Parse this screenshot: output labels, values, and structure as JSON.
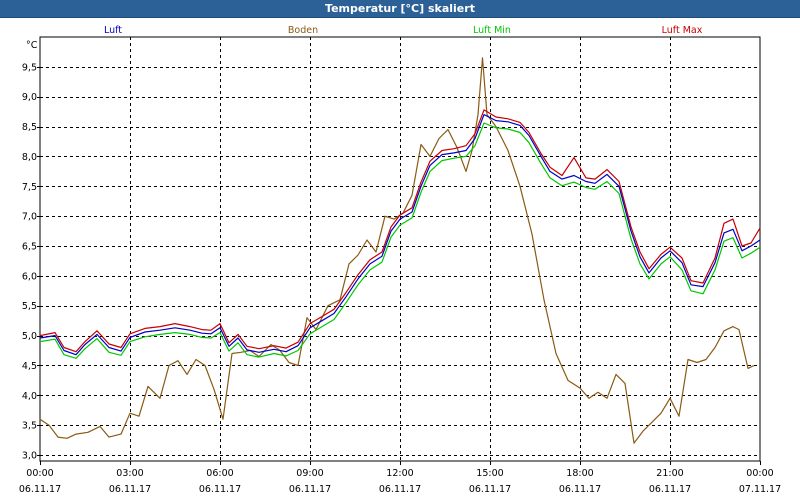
{
  "window": {
    "title": "Temperatur [°C] skaliert"
  },
  "chart_data": {
    "type": "line",
    "unit": "°C",
    "ylim": [
      2.9,
      10.0
    ],
    "yticks": [
      3.0,
      3.5,
      4.0,
      4.5,
      5.0,
      5.5,
      6.0,
      6.5,
      7.0,
      7.5,
      8.0,
      8.5,
      9.0,
      9.5
    ],
    "ytick_labels": [
      "3,0",
      "3,5",
      "4,0",
      "4,5",
      "5,0",
      "5,5",
      "6,0",
      "6,5",
      "7,0",
      "7,5",
      "8,0",
      "8,5",
      "9,0",
      "9,5"
    ],
    "xlim": [
      0,
      24
    ],
    "xticks": [
      0,
      3,
      6,
      9,
      12,
      15,
      18,
      21,
      24
    ],
    "xtick_times": [
      "00:00",
      "03:00",
      "06:00",
      "09:00",
      "12:00",
      "15:00",
      "18:00",
      "21:00",
      "00:00"
    ],
    "xtick_dates": [
      "06.11.17",
      "06.11.17",
      "06.11.17",
      "06.11.17",
      "06.11.17",
      "06.11.17",
      "06.11.17",
      "06.11.17",
      "07.11.17"
    ],
    "grid": true,
    "legend_position": "top",
    "series": [
      {
        "name": "Luft",
        "color": "#0000c8",
        "points": [
          [
            0,
            4.96
          ],
          [
            0.5,
            5.0
          ],
          [
            0.8,
            4.75
          ],
          [
            1.2,
            4.68
          ],
          [
            1.5,
            4.85
          ],
          [
            1.9,
            5.02
          ],
          [
            2.3,
            4.8
          ],
          [
            2.7,
            4.74
          ],
          [
            3.0,
            4.97
          ],
          [
            3.5,
            5.06
          ],
          [
            4.0,
            5.09
          ],
          [
            4.5,
            5.13
          ],
          [
            5.0,
            5.09
          ],
          [
            5.4,
            5.04
          ],
          [
            5.7,
            5.03
          ],
          [
            6.0,
            5.13
          ],
          [
            6.3,
            4.82
          ],
          [
            6.6,
            4.96
          ],
          [
            6.9,
            4.76
          ],
          [
            7.3,
            4.72
          ],
          [
            7.8,
            4.77
          ],
          [
            8.2,
            4.73
          ],
          [
            8.6,
            4.83
          ],
          [
            9.0,
            5.13
          ],
          [
            9.4,
            5.25
          ],
          [
            9.8,
            5.37
          ],
          [
            10.2,
            5.65
          ],
          [
            10.6,
            5.95
          ],
          [
            11.0,
            6.2
          ],
          [
            11.4,
            6.33
          ],
          [
            11.7,
            6.75
          ],
          [
            12.0,
            6.95
          ],
          [
            12.4,
            7.07
          ],
          [
            12.7,
            7.5
          ],
          [
            13.0,
            7.85
          ],
          [
            13.4,
            8.03
          ],
          [
            13.8,
            8.06
          ],
          [
            14.2,
            8.1
          ],
          [
            14.5,
            8.3
          ],
          [
            14.8,
            8.7
          ],
          [
            15.2,
            8.6
          ],
          [
            15.6,
            8.58
          ],
          [
            16.0,
            8.52
          ],
          [
            16.3,
            8.35
          ],
          [
            16.7,
            8.0
          ],
          [
            17.0,
            7.75
          ],
          [
            17.4,
            7.62
          ],
          [
            17.8,
            7.68
          ],
          [
            18.2,
            7.58
          ],
          [
            18.5,
            7.55
          ],
          [
            18.9,
            7.7
          ],
          [
            19.3,
            7.5
          ],
          [
            19.7,
            6.75
          ],
          [
            20.0,
            6.32
          ],
          [
            20.3,
            6.05
          ],
          [
            20.7,
            6.3
          ],
          [
            21.0,
            6.42
          ],
          [
            21.4,
            6.22
          ],
          [
            21.7,
            5.85
          ],
          [
            22.1,
            5.82
          ],
          [
            22.5,
            6.22
          ],
          [
            22.8,
            6.72
          ],
          [
            23.1,
            6.78
          ],
          [
            23.4,
            6.42
          ],
          [
            23.7,
            6.5
          ],
          [
            24.0,
            6.6
          ]
        ]
      },
      {
        "name": "Boden",
        "color": "#8b5a14",
        "points": [
          [
            0,
            3.6
          ],
          [
            0.3,
            3.5
          ],
          [
            0.6,
            3.3
          ],
          [
            0.9,
            3.28
          ],
          [
            1.2,
            3.35
          ],
          [
            1.6,
            3.38
          ],
          [
            2.0,
            3.48
          ],
          [
            2.3,
            3.3
          ],
          [
            2.7,
            3.35
          ],
          [
            3.0,
            3.7
          ],
          [
            3.3,
            3.65
          ],
          [
            3.6,
            4.15
          ],
          [
            4.0,
            3.95
          ],
          [
            4.3,
            4.5
          ],
          [
            4.6,
            4.58
          ],
          [
            4.9,
            4.35
          ],
          [
            5.2,
            4.6
          ],
          [
            5.5,
            4.5
          ],
          [
            5.8,
            4.1
          ],
          [
            6.1,
            3.6
          ],
          [
            6.4,
            4.7
          ],
          [
            6.7,
            4.72
          ],
          [
            7.0,
            4.75
          ],
          [
            7.3,
            4.65
          ],
          [
            7.7,
            4.85
          ],
          [
            8.0,
            4.75
          ],
          [
            8.3,
            4.55
          ],
          [
            8.6,
            4.5
          ],
          [
            8.9,
            5.3
          ],
          [
            9.2,
            5.1
          ],
          [
            9.6,
            5.5
          ],
          [
            10.0,
            5.6
          ],
          [
            10.3,
            6.2
          ],
          [
            10.6,
            6.35
          ],
          [
            10.9,
            6.6
          ],
          [
            11.2,
            6.4
          ],
          [
            11.5,
            7.0
          ],
          [
            11.8,
            6.95
          ],
          [
            12.1,
            7.05
          ],
          [
            12.4,
            7.35
          ],
          [
            12.7,
            8.2
          ],
          [
            13.0,
            8.0
          ],
          [
            13.3,
            8.3
          ],
          [
            13.6,
            8.45
          ],
          [
            13.9,
            8.15
          ],
          [
            14.2,
            7.75
          ],
          [
            14.4,
            8.1
          ],
          [
            14.6,
            8.7
          ],
          [
            14.75,
            9.65
          ],
          [
            14.9,
            8.7
          ],
          [
            15.2,
            8.5
          ],
          [
            15.6,
            8.1
          ],
          [
            16.0,
            7.5
          ],
          [
            16.4,
            6.7
          ],
          [
            16.8,
            5.6
          ],
          [
            17.2,
            4.7
          ],
          [
            17.6,
            4.25
          ],
          [
            18.0,
            4.12
          ],
          [
            18.3,
            3.95
          ],
          [
            18.6,
            4.05
          ],
          [
            18.9,
            3.95
          ],
          [
            19.2,
            4.35
          ],
          [
            19.5,
            4.2
          ],
          [
            19.8,
            3.2
          ],
          [
            20.1,
            3.4
          ],
          [
            20.4,
            3.55
          ],
          [
            20.7,
            3.7
          ],
          [
            21.0,
            3.95
          ],
          [
            21.3,
            3.65
          ],
          [
            21.6,
            4.6
          ],
          [
            21.9,
            4.55
          ],
          [
            22.2,
            4.6
          ],
          [
            22.5,
            4.8
          ],
          [
            22.8,
            5.08
          ],
          [
            23.1,
            5.15
          ],
          [
            23.3,
            5.1
          ],
          [
            23.6,
            4.45
          ],
          [
            23.8,
            4.5
          ]
        ]
      },
      {
        "name": "Luft Min",
        "color": "#00c800",
        "points": [
          [
            0,
            4.9
          ],
          [
            0.5,
            4.94
          ],
          [
            0.8,
            4.68
          ],
          [
            1.2,
            4.62
          ],
          [
            1.5,
            4.78
          ],
          [
            1.9,
            4.95
          ],
          [
            2.3,
            4.72
          ],
          [
            2.7,
            4.67
          ],
          [
            3.0,
            4.9
          ],
          [
            3.5,
            4.98
          ],
          [
            4.0,
            5.02
          ],
          [
            4.5,
            5.05
          ],
          [
            5.0,
            5.02
          ],
          [
            5.4,
            4.97
          ],
          [
            5.7,
            4.96
          ],
          [
            6.0,
            5.05
          ],
          [
            6.3,
            4.74
          ],
          [
            6.6,
            4.88
          ],
          [
            6.9,
            4.68
          ],
          [
            7.3,
            4.64
          ],
          [
            7.8,
            4.7
          ],
          [
            8.2,
            4.66
          ],
          [
            8.6,
            4.75
          ],
          [
            9.0,
            5.03
          ],
          [
            9.4,
            5.15
          ],
          [
            9.8,
            5.27
          ],
          [
            10.2,
            5.55
          ],
          [
            10.6,
            5.85
          ],
          [
            11.0,
            6.1
          ],
          [
            11.4,
            6.23
          ],
          [
            11.7,
            6.65
          ],
          [
            12.0,
            6.85
          ],
          [
            12.4,
            6.97
          ],
          [
            12.7,
            7.4
          ],
          [
            13.0,
            7.75
          ],
          [
            13.4,
            7.93
          ],
          [
            13.8,
            7.97
          ],
          [
            14.2,
            8.0
          ],
          [
            14.5,
            8.18
          ],
          [
            14.8,
            8.56
          ],
          [
            15.2,
            8.48
          ],
          [
            15.6,
            8.46
          ],
          [
            16.0,
            8.4
          ],
          [
            16.3,
            8.23
          ],
          [
            16.7,
            7.88
          ],
          [
            17.0,
            7.64
          ],
          [
            17.4,
            7.51
          ],
          [
            17.8,
            7.57
          ],
          [
            18.2,
            7.48
          ],
          [
            18.5,
            7.45
          ],
          [
            18.9,
            7.58
          ],
          [
            19.3,
            7.38
          ],
          [
            19.7,
            6.62
          ],
          [
            20.0,
            6.2
          ],
          [
            20.3,
            5.95
          ],
          [
            20.7,
            6.2
          ],
          [
            21.0,
            6.32
          ],
          [
            21.4,
            6.1
          ],
          [
            21.7,
            5.75
          ],
          [
            22.1,
            5.7
          ],
          [
            22.5,
            6.1
          ],
          [
            22.8,
            6.58
          ],
          [
            23.1,
            6.64
          ],
          [
            23.4,
            6.3
          ],
          [
            23.7,
            6.38
          ],
          [
            24.0,
            6.48
          ]
        ]
      },
      {
        "name": "Luft Max",
        "color": "#c80000",
        "points": [
          [
            0,
            5.0
          ],
          [
            0.5,
            5.05
          ],
          [
            0.8,
            4.8
          ],
          [
            1.2,
            4.73
          ],
          [
            1.5,
            4.9
          ],
          [
            1.9,
            5.08
          ],
          [
            2.3,
            4.86
          ],
          [
            2.7,
            4.8
          ],
          [
            3.0,
            5.03
          ],
          [
            3.5,
            5.12
          ],
          [
            4.0,
            5.15
          ],
          [
            4.5,
            5.2
          ],
          [
            5.0,
            5.15
          ],
          [
            5.4,
            5.1
          ],
          [
            5.7,
            5.09
          ],
          [
            6.0,
            5.2
          ],
          [
            6.3,
            4.88
          ],
          [
            6.6,
            5.02
          ],
          [
            6.9,
            4.82
          ],
          [
            7.3,
            4.78
          ],
          [
            7.8,
            4.83
          ],
          [
            8.2,
            4.79
          ],
          [
            8.6,
            4.89
          ],
          [
            9.0,
            5.2
          ],
          [
            9.4,
            5.32
          ],
          [
            9.8,
            5.44
          ],
          [
            10.2,
            5.72
          ],
          [
            10.6,
            6.02
          ],
          [
            11.0,
            6.27
          ],
          [
            11.4,
            6.4
          ],
          [
            11.7,
            6.82
          ],
          [
            12.0,
            7.02
          ],
          [
            12.4,
            7.14
          ],
          [
            12.7,
            7.57
          ],
          [
            13.0,
            7.92
          ],
          [
            13.4,
            8.1
          ],
          [
            13.8,
            8.13
          ],
          [
            14.2,
            8.18
          ],
          [
            14.5,
            8.38
          ],
          [
            14.8,
            8.78
          ],
          [
            15.2,
            8.66
          ],
          [
            15.6,
            8.63
          ],
          [
            16.0,
            8.57
          ],
          [
            16.3,
            8.4
          ],
          [
            16.7,
            8.05
          ],
          [
            17.0,
            7.82
          ],
          [
            17.4,
            7.68
          ],
          [
            17.8,
            7.98
          ],
          [
            18.2,
            7.64
          ],
          [
            18.5,
            7.62
          ],
          [
            18.9,
            7.78
          ],
          [
            19.3,
            7.58
          ],
          [
            19.7,
            6.82
          ],
          [
            20.0,
            6.4
          ],
          [
            20.3,
            6.12
          ],
          [
            20.7,
            6.36
          ],
          [
            21.0,
            6.48
          ],
          [
            21.4,
            6.3
          ],
          [
            21.7,
            5.92
          ],
          [
            22.1,
            5.88
          ],
          [
            22.5,
            6.3
          ],
          [
            22.8,
            6.88
          ],
          [
            23.1,
            6.95
          ],
          [
            23.4,
            6.5
          ],
          [
            23.7,
            6.55
          ],
          [
            24.0,
            6.8
          ]
        ]
      }
    ]
  }
}
